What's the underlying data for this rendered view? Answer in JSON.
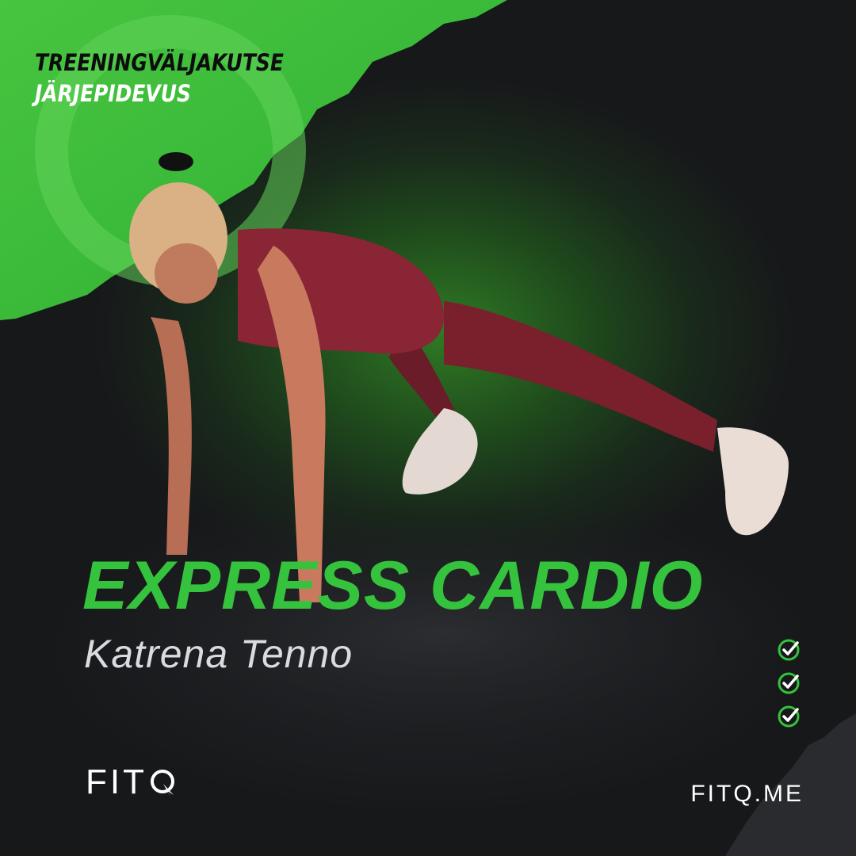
{
  "challenge": {
    "line1": "TREENINGVÄLJAKUTSE",
    "line2": "JÄRJEPIDEVUS"
  },
  "workout": {
    "title": "EXPRESS CARDIO",
    "trainer": "Katrena Tenno"
  },
  "checklist": {
    "count": 3,
    "icon": "check-circle-icon",
    "color": "#35c23c"
  },
  "brand": {
    "logo_text": "FIT",
    "logo_icon": "q-bolt-icon",
    "website": "FITQ.ME"
  },
  "colors": {
    "accent_green": "#35c23c",
    "background": "#151617",
    "text_light": "#d9dbe0"
  }
}
